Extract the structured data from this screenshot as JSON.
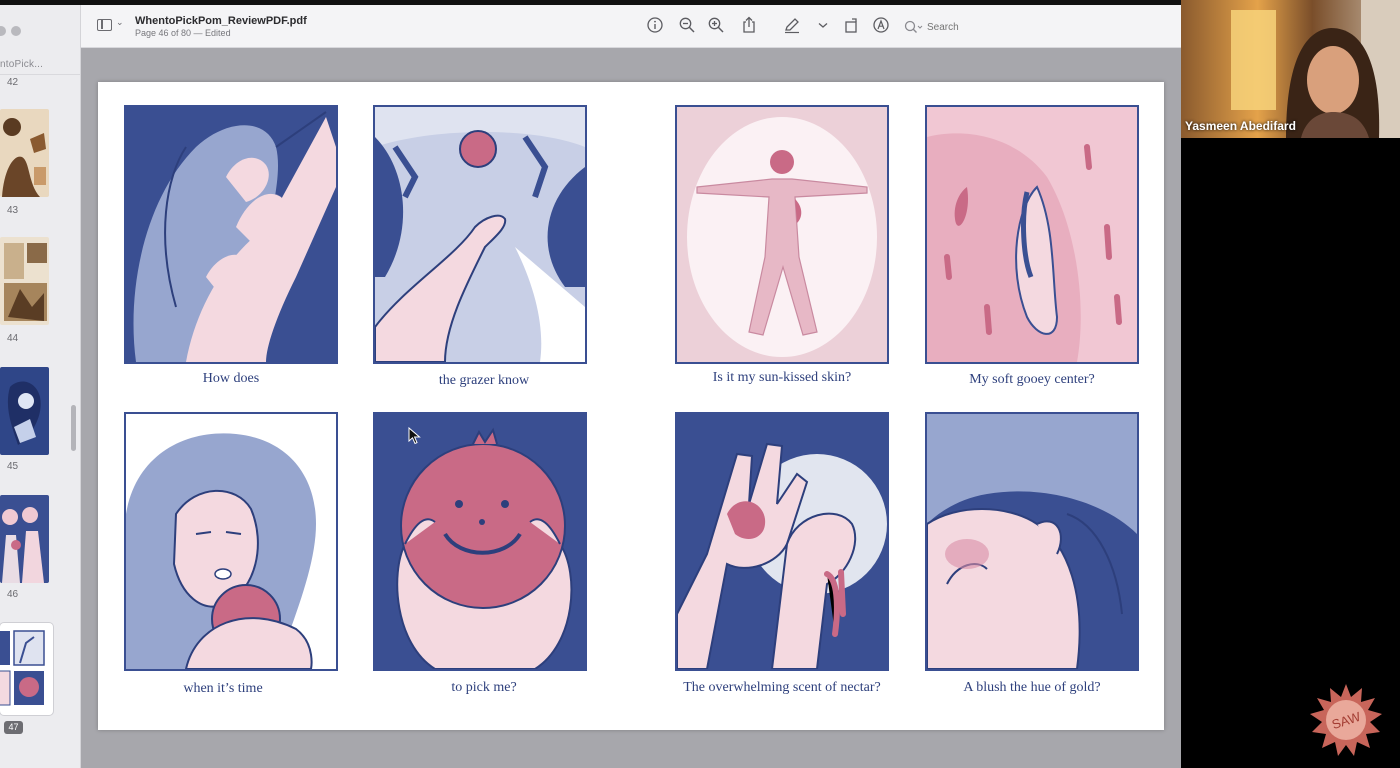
{
  "viewer": {
    "doc_title": "WhentoPickPom_ReviewPDF.pdf",
    "doc_subtitle": "Page 46 of 80 — Edited",
    "search_placeholder": "Search"
  },
  "sidebar": {
    "title": "ntoPick...",
    "pages": [
      {
        "num": "42"
      },
      {
        "num": "43"
      },
      {
        "num": "44"
      },
      {
        "num": "45"
      },
      {
        "num": "46"
      },
      {
        "num": "47",
        "selected": true
      }
    ]
  },
  "comic": {
    "captions": [
      "How does",
      "the grazer know",
      "Is it my sun-kissed skin?",
      "My soft gooey center?",
      "when it’s time",
      "to pick me?",
      "The overwhelming scent of nectar?",
      "A blush the hue of gold?"
    ],
    "colors": {
      "ink": "#3a4f92",
      "pink": "#f4d9e0",
      "rose": "#c96a86"
    }
  },
  "call": {
    "participant_name": "Yasmeen Abedifard",
    "logo_text": "SAW"
  }
}
